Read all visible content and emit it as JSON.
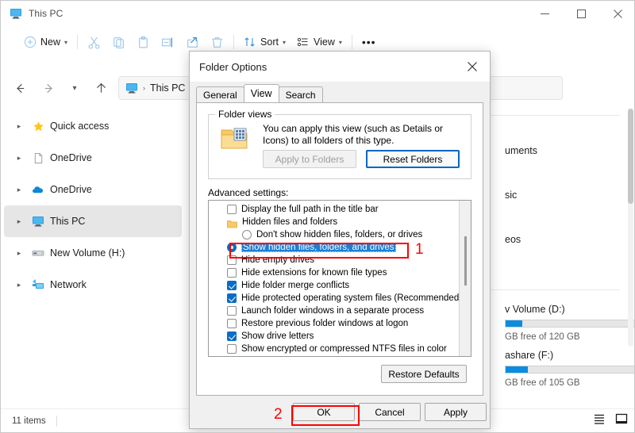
{
  "window": {
    "title": "This PC",
    "app_icon": "this-pc-icon",
    "minimize_label": "Minimize",
    "maximize_label": "Maximize",
    "close_label": "Close"
  },
  "toolbar": {
    "new_label": "New",
    "sort_label": "Sort",
    "view_label": "View",
    "more_label": "•••",
    "items": [
      {
        "name": "cut-icon",
        "label": "Cut"
      },
      {
        "name": "copy-icon",
        "label": "Copy"
      },
      {
        "name": "paste-icon",
        "label": "Paste"
      },
      {
        "name": "rename-icon",
        "label": "Rename"
      },
      {
        "name": "share-icon",
        "label": "Share"
      },
      {
        "name": "delete-icon",
        "label": "Delete"
      }
    ]
  },
  "address": {
    "back_label": "Back",
    "forward_label": "Forward",
    "recent_label": "Recent locations",
    "up_label": "Up",
    "crumb": "This PC",
    "separator": "›"
  },
  "sidebar": {
    "items": [
      {
        "label": "Quick access",
        "icon": "star-icon",
        "selected": false
      },
      {
        "label": "OneDrive",
        "icon": "file-icon",
        "selected": false
      },
      {
        "label": "OneDrive",
        "icon": "cloud-icon",
        "selected": false
      },
      {
        "label": "This PC",
        "icon": "this-pc-icon",
        "selected": true
      },
      {
        "label": "New Volume (H:)",
        "icon": "drive-icon",
        "selected": false
      },
      {
        "label": "Network",
        "icon": "network-icon",
        "selected": false
      }
    ]
  },
  "filepane": {
    "folders": [
      {
        "label": "uments"
      },
      {
        "label": "sic"
      },
      {
        "label": "eos"
      }
    ],
    "drives": [
      {
        "label": "v Volume (D:)",
        "usage_text": "GB free of 120 GB",
        "used_percent": 13
      },
      {
        "label": "ashare (F:)",
        "usage_text": "GB free of 105 GB",
        "used_percent": 17
      }
    ]
  },
  "statusbar": {
    "item_count": "11 items",
    "list_view_label": "List view",
    "details_pane_label": "Details pane"
  },
  "dialog": {
    "title": "Folder Options",
    "close_label": "Close",
    "tabs": [
      {
        "label": "General",
        "active": false
      },
      {
        "label": "View",
        "active": true
      },
      {
        "label": "Search",
        "active": false
      }
    ],
    "folder_views": {
      "legend": "Folder views",
      "description": "You can apply this view (such as Details or Icons) to all folders of this type.",
      "apply_button": "Apply to Folders",
      "reset_button": "Reset Folders",
      "apply_disabled": true
    },
    "advanced_label": "Advanced settings:",
    "advanced_settings": [
      {
        "label": "Display the full path in the title bar",
        "type": "checkbox",
        "checked": false,
        "indent": 0,
        "selected": false
      },
      {
        "label": "Hidden files and folders",
        "type": "folder",
        "checked": false,
        "indent": 0,
        "selected": false
      },
      {
        "label": "Don't show hidden files, folders, or drives",
        "type": "radio",
        "checked": false,
        "indent": 1,
        "selected": false
      },
      {
        "label": "Show hidden files, folders, and drives",
        "type": "radio",
        "checked": true,
        "indent": 1,
        "selected": true
      },
      {
        "label": "Hide empty drives",
        "type": "checkbox",
        "checked": false,
        "indent": 0,
        "selected": false
      },
      {
        "label": "Hide extensions for known file types",
        "type": "checkbox",
        "checked": false,
        "indent": 0,
        "selected": false
      },
      {
        "label": "Hide folder merge conflicts",
        "type": "checkbox",
        "checked": true,
        "indent": 0,
        "selected": false
      },
      {
        "label": "Hide protected operating system files (Recommended)",
        "type": "checkbox",
        "checked": true,
        "indent": 0,
        "selected": false
      },
      {
        "label": "Launch folder windows in a separate process",
        "type": "checkbox",
        "checked": false,
        "indent": 0,
        "selected": false
      },
      {
        "label": "Restore previous folder windows at logon",
        "type": "checkbox",
        "checked": false,
        "indent": 0,
        "selected": false
      },
      {
        "label": "Show drive letters",
        "type": "checkbox",
        "checked": true,
        "indent": 0,
        "selected": false
      },
      {
        "label": "Show encrypted or compressed NTFS files in color",
        "type": "checkbox",
        "checked": false,
        "indent": 0,
        "selected": false
      }
    ],
    "restore_defaults": "Restore Defaults",
    "ok_button": "OK",
    "cancel_button": "Cancel",
    "apply_button": "Apply"
  },
  "annotations": {
    "step1": "1",
    "step2": "2",
    "color": "#ff0000"
  },
  "colors": {
    "accent": "#0067c0",
    "selection_blue": "#1b7fd4",
    "checkbox_blue": "#0a6cc4",
    "annotation_red": "#ff0000",
    "drive_bar": "#0c8ce0"
  }
}
